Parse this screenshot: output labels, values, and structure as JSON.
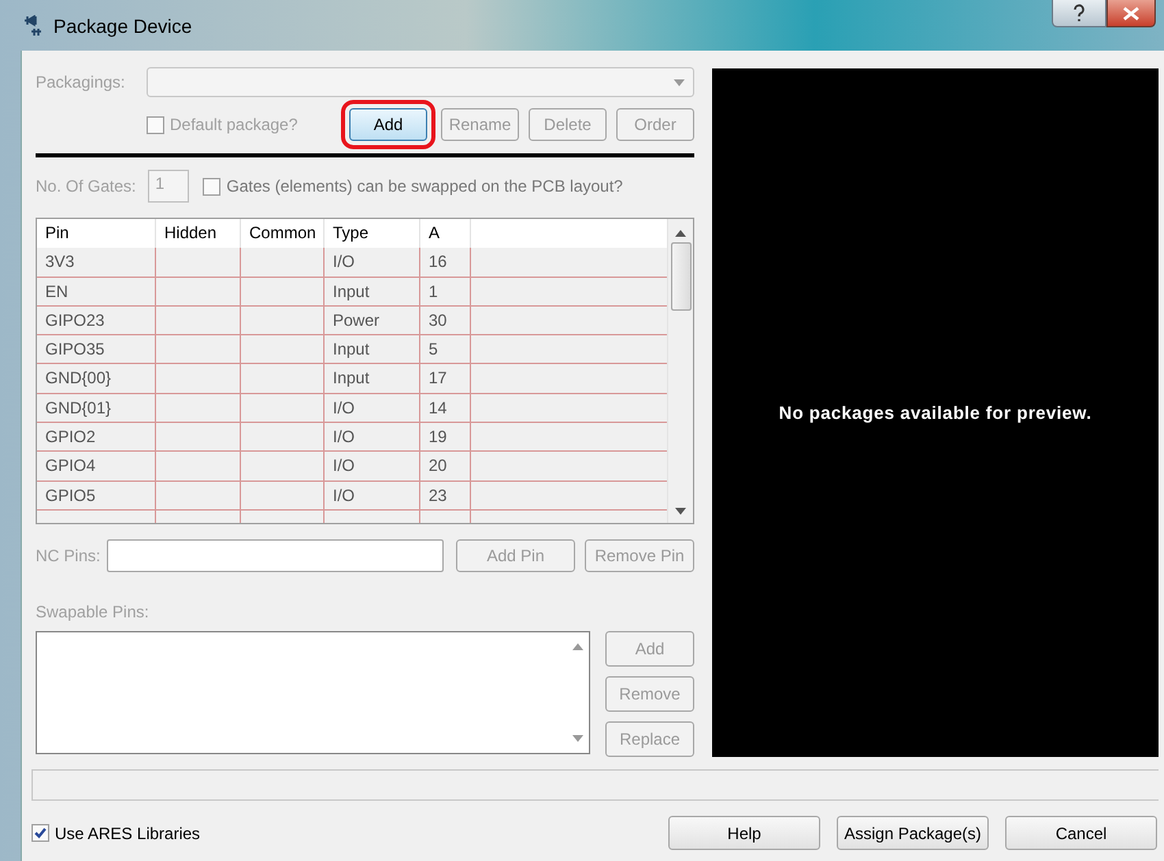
{
  "window": {
    "title": "Package Device"
  },
  "packagings": {
    "label": "Packagings:",
    "disabled": true
  },
  "default_package": {
    "label": "Default package?",
    "checked": false
  },
  "package_buttons": [
    {
      "label": "Add",
      "disabled": false,
      "highlighted": true
    },
    {
      "label": "Rename",
      "disabled": true,
      "highlighted": false
    },
    {
      "label": "Delete",
      "disabled": true,
      "highlighted": false
    },
    {
      "label": "Order",
      "disabled": true,
      "highlighted": false
    }
  ],
  "gates": {
    "label": "No. Of Gates:",
    "value": "1",
    "swap_label": "Gates (elements) can be swapped on the PCB layout?",
    "swap_checked": false
  },
  "table": {
    "columns": [
      "Pin",
      "Hidden",
      "Common",
      "Type",
      "A"
    ],
    "rows": [
      [
        "3V3",
        "",
        "",
        "I/O",
        "16"
      ],
      [
        "EN",
        "",
        "",
        "Input",
        "1"
      ],
      [
        "GIPO23",
        "",
        "",
        "Power",
        "30"
      ],
      [
        "GIPO35",
        "",
        "",
        "Input",
        "5"
      ],
      [
        "GND{00}",
        "",
        "",
        "Input",
        "17"
      ],
      [
        "GND{01}",
        "",
        "",
        "I/O",
        "14"
      ],
      [
        "GPIO2",
        "",
        "",
        "I/O",
        "19"
      ],
      [
        "GPIO4",
        "",
        "",
        "I/O",
        "20"
      ],
      [
        "GPIO5",
        "",
        "",
        "I/O",
        "23"
      ]
    ]
  },
  "nc_pins": {
    "label": "NC Pins:",
    "buttons": [
      "Add Pin",
      "Remove Pin"
    ]
  },
  "swapable_pins": {
    "label": "Swapable Pins:",
    "buttons": [
      "Add",
      "Remove",
      "Replace"
    ]
  },
  "preview": {
    "message": "No packages available for preview."
  },
  "use_ares": {
    "label": "Use ARES Libraries",
    "checked": true
  },
  "footer_buttons": [
    "Help",
    "Assign Package(s)",
    "Cancel"
  ]
}
